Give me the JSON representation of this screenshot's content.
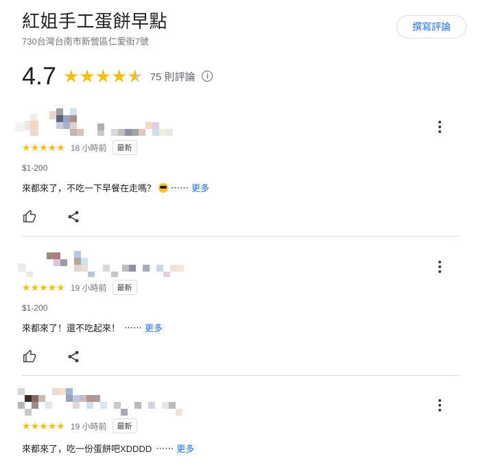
{
  "place": {
    "title": "紅姐手工蛋餅早點",
    "address": "730台灣台南市新營區仁愛街7號",
    "write_review": "撰寫評論"
  },
  "summary": {
    "rating": "4.7",
    "stars": 4.7,
    "count_label": "75 則評論",
    "info_icon": "info-icon"
  },
  "reviews": [
    {
      "stars": 5,
      "time": "18 小時前",
      "badge": "最新",
      "price": "$1-200",
      "text": "來都來了，不吃一下早餐在走嗎？",
      "has_emoji": true,
      "ellipsis": "⋯⋯",
      "more": "更多"
    },
    {
      "stars": 5,
      "time": "19 小時前",
      "badge": "最新",
      "price": "$1-200",
      "text": "來都來了！還不吃起來！",
      "has_emoji": false,
      "ellipsis": "⋯⋯",
      "more": "更多"
    },
    {
      "stars": 5,
      "time": "19 小時前",
      "badge": "最新",
      "price": "",
      "text": "來都來了，吃一份蛋餅吧XDDDD",
      "has_emoji": false,
      "ellipsis": "⋯⋯",
      "more": "更多"
    }
  ],
  "colors": {
    "star": "#fbbc04",
    "link": "#1a73e8",
    "divider": "#dadce0"
  },
  "icons": [
    "more-vert-icon",
    "thumb-up-icon",
    "share-icon",
    "star-icon"
  ]
}
